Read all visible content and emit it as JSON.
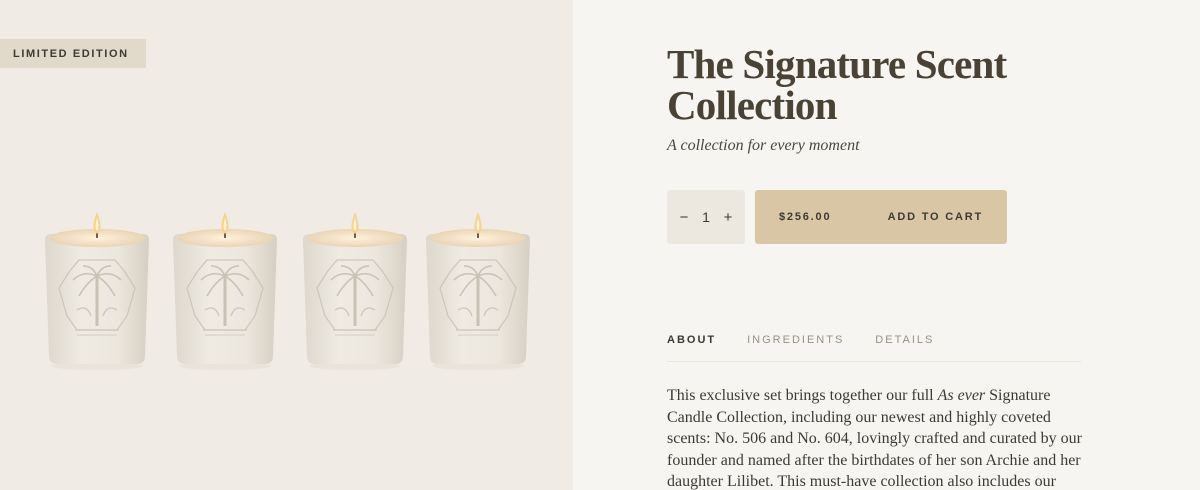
{
  "badge": {
    "label": "LIMITED EDITION"
  },
  "product": {
    "title": "The Signature Scent Collection",
    "subtitle": "A collection for every moment"
  },
  "quantity": {
    "minus": "−",
    "value": "1",
    "plus": "+"
  },
  "cart": {
    "price": "$256.00",
    "label": "ADD TO CART"
  },
  "tabs": [
    {
      "label": "ABOUT",
      "active": true
    },
    {
      "label": "INGREDIENTS",
      "active": false
    },
    {
      "label": "DETAILS",
      "active": false
    }
  ],
  "description": {
    "part1": "This exclusive set brings together our full ",
    "emphasis": "As ever",
    "part2": " Signature Candle Collection, including our newest and highly coveted scents: No. 506 and No. 604, lovingly crafted and curated by our founder and named after the birthdates of her son Archie and her daughter Lilibet. This must-have collection also includes our"
  },
  "colors": {
    "left_panel": "#f0ebe5",
    "right_panel": "#f7f5f1",
    "badge": "#e1d9ca",
    "cart_button": "#d9c6a5",
    "qty_box": "#ece8e0",
    "text": "#3d3a34"
  },
  "image": {
    "candle_count": 4,
    "motif": "palm-tree-emblem"
  }
}
